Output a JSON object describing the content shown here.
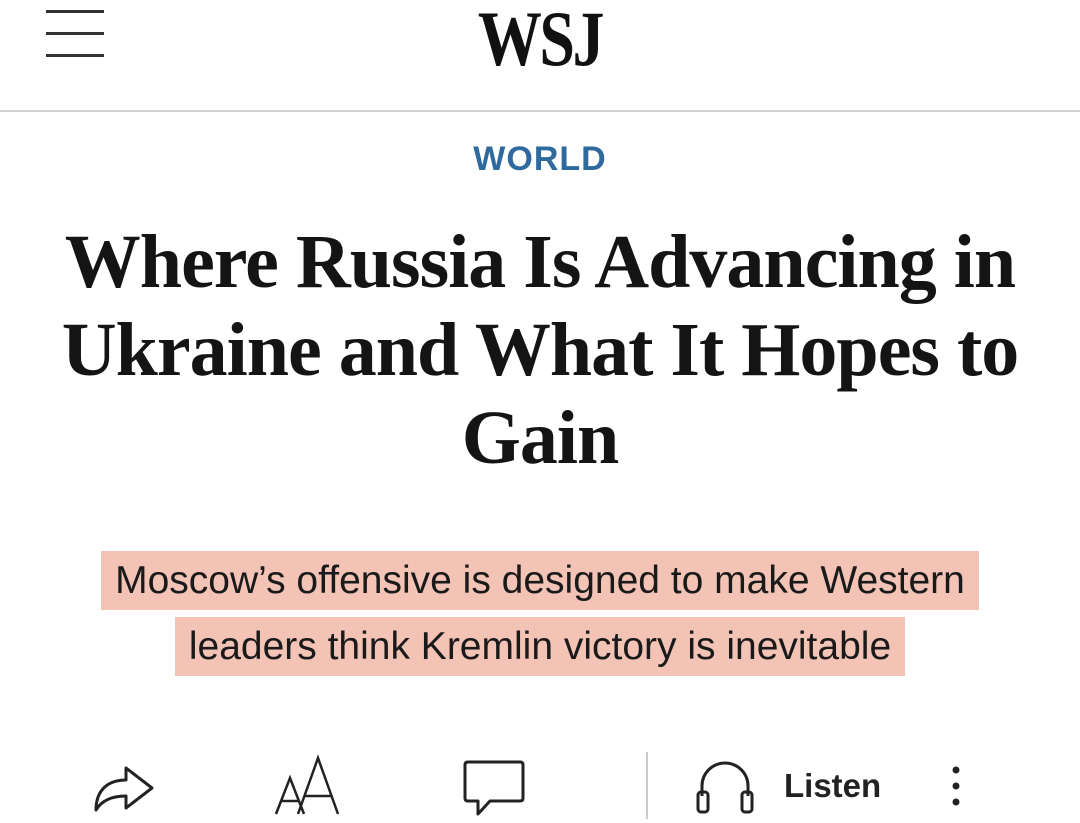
{
  "header": {
    "logo": "WSJ",
    "menu_icon": "hamburger-menu-icon"
  },
  "article": {
    "section": "WORLD",
    "section_color": "#2f6a9e",
    "headline": "Where Russia Is Advancing in Ukraine and What It Hopes to Gain",
    "dek_line1": "Moscow’s offensive is designed to make Western",
    "dek_line2": "leaders think Kremlin victory is inevitable",
    "highlight_color": "#f3c3b6"
  },
  "toolbar": {
    "share_icon": "share-arrow-icon",
    "text_size_icon": "text-size-icon",
    "comments_icon": "comment-bubble-icon",
    "listen_icon": "headphones-icon",
    "listen_label": "Listen",
    "more_icon": "more-vertical-icon"
  }
}
